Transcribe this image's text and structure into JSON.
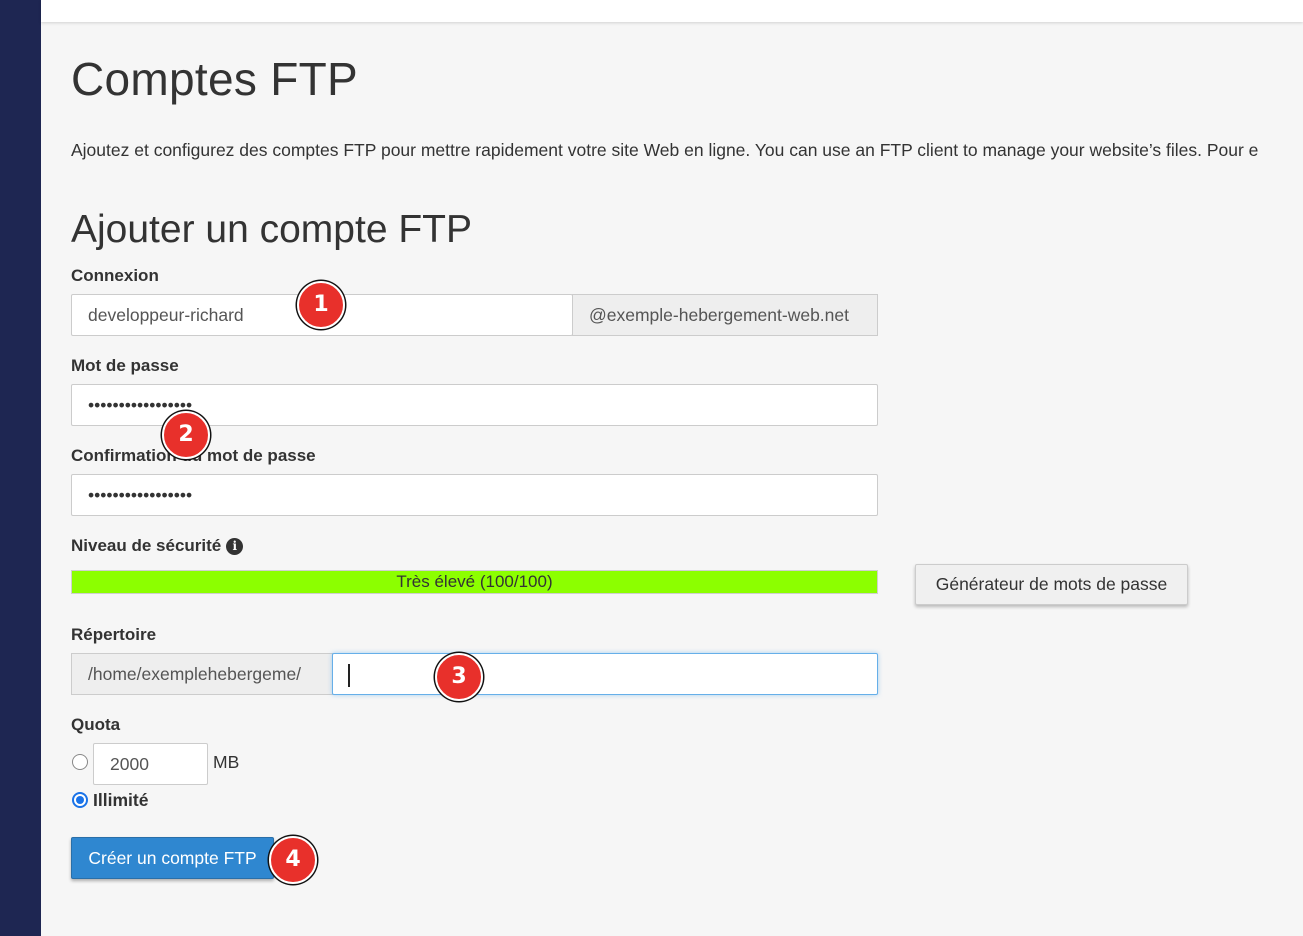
{
  "page": {
    "title": "Comptes FTP",
    "description": "Ajoutez et configurez des comptes FTP pour mettre rapidement votre site Web en ligne. You can use an FTP client to manage your website’s files. Pour e"
  },
  "form": {
    "section_title": "Ajouter un compte FTP",
    "login": {
      "label": "Connexion",
      "value": "developpeur-richard",
      "domain_suffix": "@exemple-hebergement-web.net"
    },
    "password": {
      "label": "Mot de passe",
      "value": "•••••••••••••••••"
    },
    "password_confirm": {
      "label": "Confirmation du mot de passe",
      "value": "•••••••••••••••••"
    },
    "strength": {
      "label": "Niveau de sécurité",
      "info_icon": "info-circle-icon",
      "text": "Très élevé (100/100)",
      "percent": 100,
      "color": "#8cff00"
    },
    "generator_button": "Générateur de mots de passe",
    "directory": {
      "label": "Répertoire",
      "prefix": "/home/exemplehebergeme/",
      "value": ""
    },
    "quota": {
      "label": "Quota",
      "limited_value": "2000",
      "unit": "MB",
      "unlimited_label": "Illimité",
      "selected": "unlimited"
    },
    "submit_button": "Créer un compte FTP"
  },
  "step_markers": [
    "1",
    "2",
    "3",
    "4"
  ],
  "colors": {
    "sidebar": "#1e2652",
    "primary_button": "#2f87d0",
    "marker": "#e8302b"
  }
}
